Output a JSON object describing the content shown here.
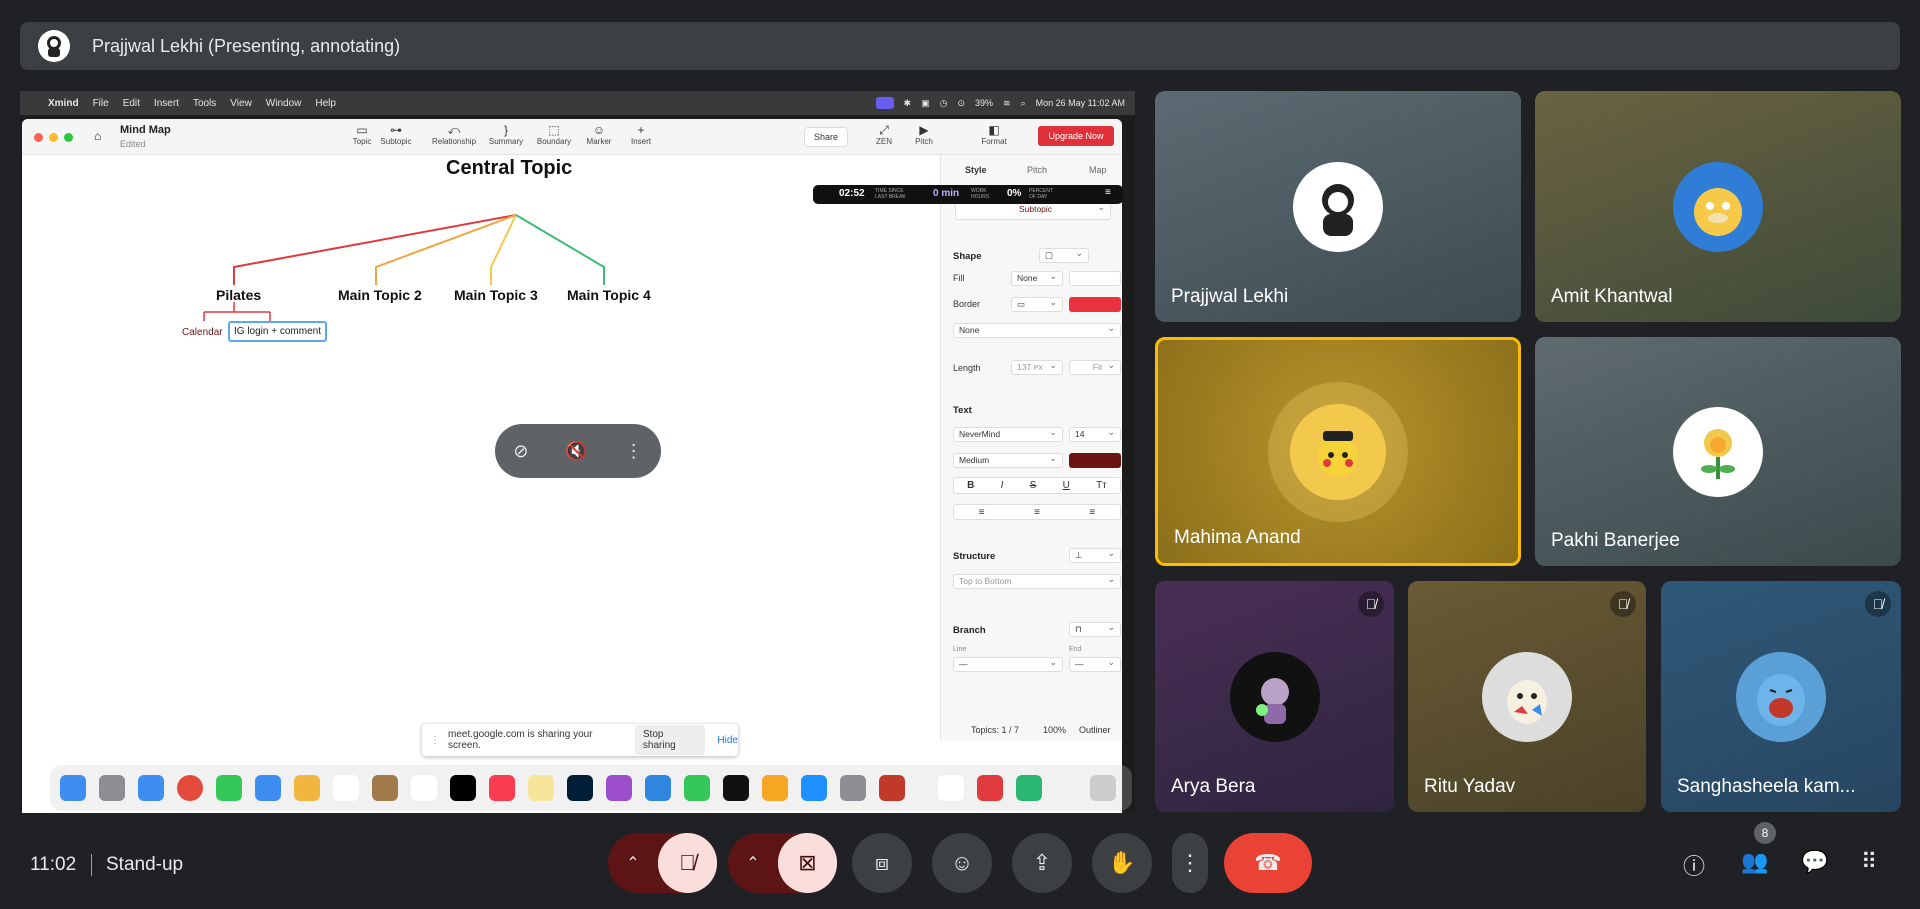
{
  "presenter_bar": {
    "title": "Prajjwal Lekhi (Presenting, annotating)",
    "avatar_icon": "presenter-avatar-icon"
  },
  "mac_menubar": {
    "app": "Xmind",
    "menus": [
      "File",
      "Edit",
      "Insert",
      "Tools",
      "View",
      "Window",
      "Help"
    ],
    "battery": "39%",
    "datetime": "Mon 26 May  11:02 AM"
  },
  "xmind": {
    "doc_title": "Mind Map",
    "doc_status": "Edited",
    "toolbar": [
      "Topic",
      "Subtopic",
      "Relationship",
      "Summary",
      "Boundary",
      "Marker",
      "Insert"
    ],
    "share_label": "Share",
    "zen_label": "ZEN",
    "pitch_label": "Pitch",
    "format_label": "Format",
    "upgrade_label": "Upgrade Now",
    "tabs": [
      "Style",
      "Pitch",
      "Map"
    ],
    "timer": {
      "time": "02:52",
      "time_caption": "TIME SINCE LAST BREAK",
      "mins": "0 min",
      "mins_caption": "WORK HOURS",
      "pct": "0%",
      "pct_caption": "PERCENT OF DAY"
    },
    "style_dropdown": "Subtopic",
    "shape": {
      "header": "Shape",
      "fill_label": "Fill",
      "fill_value": "None",
      "border_label": "Border",
      "border_color": "#e8333f",
      "line_value": "None"
    },
    "length": {
      "label": "Length",
      "value": "137",
      "unit": "PX",
      "fit": "Fit"
    },
    "text": {
      "header": "Text",
      "font": "NeverMind",
      "size": "14",
      "weight": "Medium",
      "color": "#6b1414",
      "bold": "B",
      "italic": "I",
      "strike": "S",
      "underline": "U",
      "case": "Tт"
    },
    "structure": {
      "header": "Structure",
      "value": "Top to Bottom"
    },
    "branch": {
      "header": "Branch",
      "line_label": "Line",
      "end_label": "End"
    },
    "footer": {
      "topics": "Topics: 1 / 7",
      "zoom": "100%",
      "outliner": "Outliner"
    },
    "map": {
      "central": "Central Topic",
      "main_topics": [
        "Pilates",
        "Main Topic 2",
        "Main Topic 3",
        "Main Topic 4"
      ],
      "subtopics": [
        "Calendar",
        "IG login + comment"
      ]
    }
  },
  "sharing_notice": {
    "text": "meet.google.com is sharing your screen.",
    "stop": "Stop sharing",
    "hide": "Hide"
  },
  "participants": [
    {
      "name": "Prajjwal Lekhi"
    },
    {
      "name": "Amit Khantwal"
    },
    {
      "name": "Mahima Anand"
    },
    {
      "name": "Pakhi Banerjee"
    },
    {
      "name": "Arya Bera"
    },
    {
      "name": "Ritu Yadav"
    },
    {
      "name": "Sanghasheela kam..."
    }
  ],
  "bottom_bar": {
    "time": "11:02",
    "meeting": "Stand-up",
    "people_count": "8"
  },
  "colors": {
    "end_call": "#ea4335",
    "muted_bg": "#f9dedc",
    "active_speaker": "#fbbc04",
    "topic_red": "#e0393e",
    "topic_orange": "#f0a640",
    "topic_yellow": "#f2c94c",
    "topic_green": "#3dbb74"
  }
}
